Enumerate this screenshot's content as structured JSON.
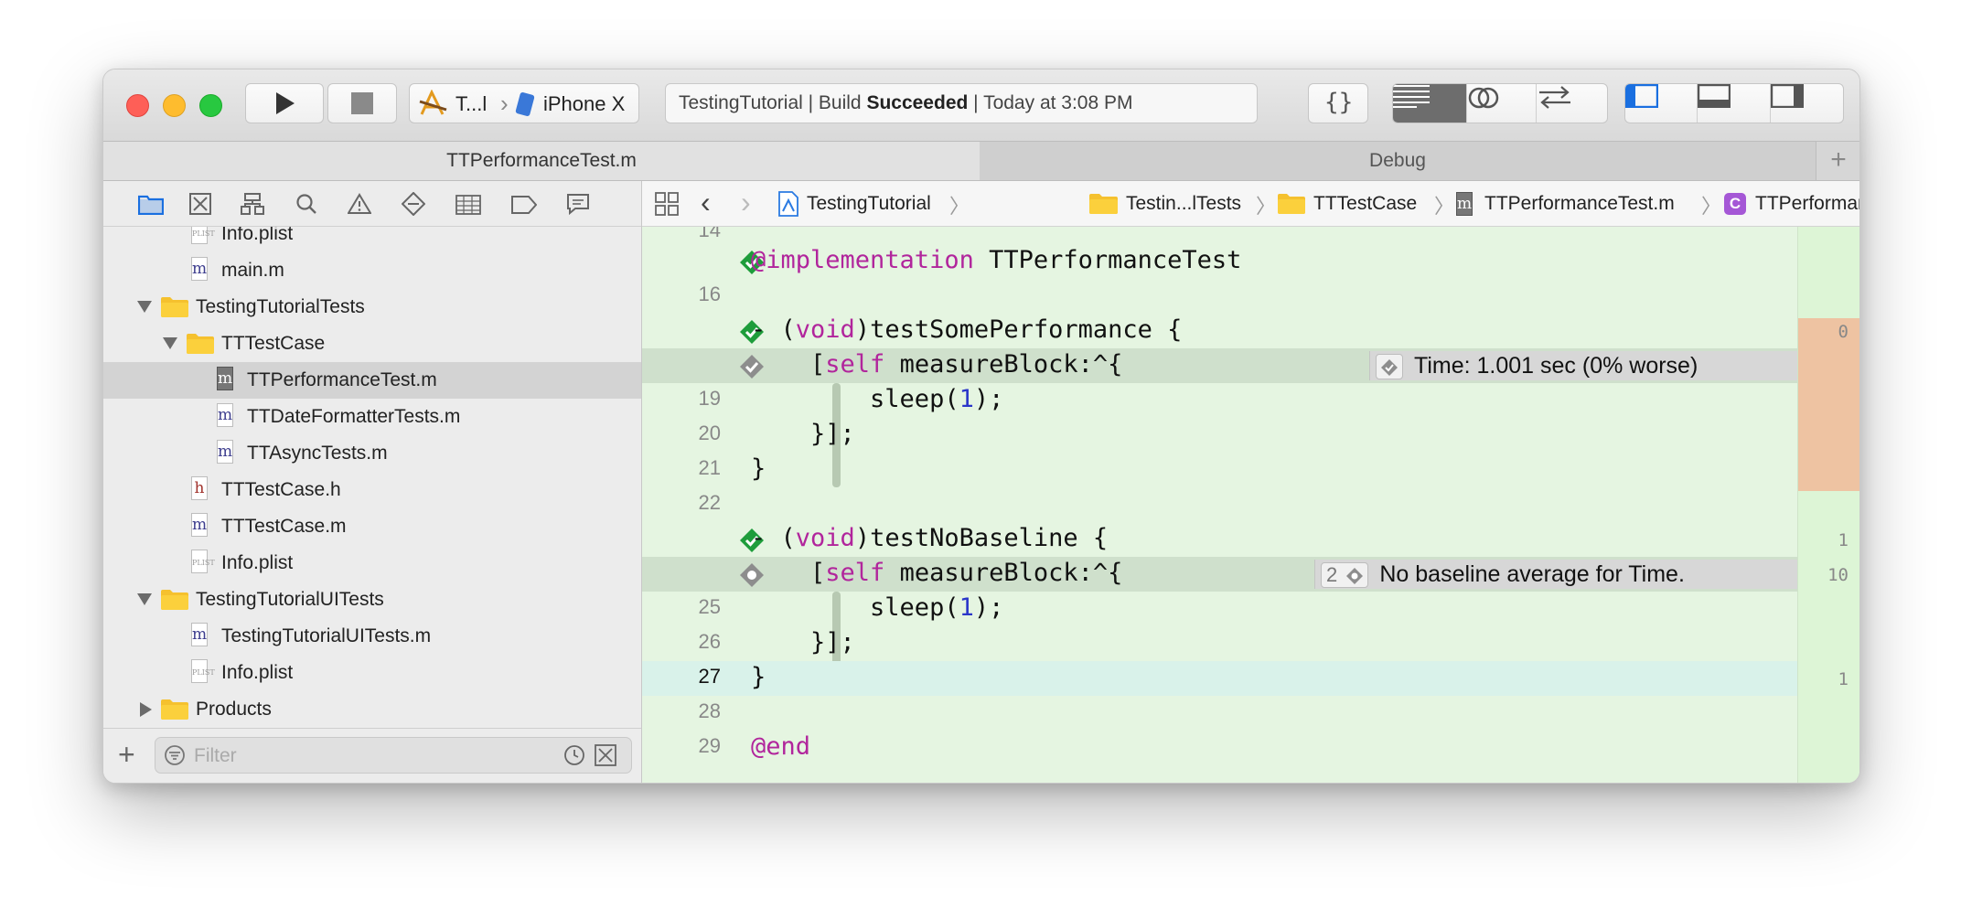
{
  "toolbar": {
    "scheme_name": "T...l",
    "device_name": "iPhone X",
    "activity": {
      "prefix": "TestingTutorial | Build ",
      "status": "Succeeded",
      "suffix": " | Today at 3:08 PM"
    }
  },
  "tabs": [
    {
      "label": "TTPerformanceTest.m",
      "active": true
    },
    {
      "label": "Debug",
      "active": false
    }
  ],
  "navigator": {
    "items": [
      {
        "label": "Info.plist",
        "icon": "plist-file-icon"
      },
      {
        "label": "main.m",
        "icon": "m-file-icon"
      },
      {
        "label": "TestingTutorialTests",
        "icon": "folder-icon",
        "expanded": true
      },
      {
        "label": "TTTestCase",
        "icon": "folder-icon",
        "expanded": true
      },
      {
        "label": "TTPerformanceTest.m",
        "icon": "m-file-icon",
        "selected": true
      },
      {
        "label": "TTDateFormatterTests.m",
        "icon": "m-file-icon"
      },
      {
        "label": "TTAsyncTests.m",
        "icon": "m-file-icon"
      },
      {
        "label": "TTTestCase.h",
        "icon": "h-file-icon"
      },
      {
        "label": "TTTestCase.m",
        "icon": "m-file-icon"
      },
      {
        "label": "Info.plist",
        "icon": "plist-file-icon"
      },
      {
        "label": "TestingTutorialUITests",
        "icon": "folder-icon",
        "expanded": true
      },
      {
        "label": "TestingTutorialUITests.m",
        "icon": "m-file-icon"
      },
      {
        "label": "Info.plist",
        "icon": "plist-file-icon"
      },
      {
        "label": "Products",
        "icon": "folder-icon",
        "expanded": false
      }
    ],
    "file_letters": {
      "m": "m",
      "h": "h"
    },
    "filter_placeholder": "Filter"
  },
  "jumpbar": {
    "crumbs": [
      "TestingTutorial",
      "Testin...lTests",
      "TTTestCase",
      "TTPerformanceTest.m",
      "TTPerformanceTest"
    ],
    "class_badge": "C"
  },
  "code": {
    "lines": [
      {
        "num": "14",
        "text": ""
      },
      {
        "num": "",
        "kw": "@implementation",
        "rest": " TTPerformanceTest",
        "marker": "pass"
      },
      {
        "num": "16",
        "text": ""
      },
      {
        "num": "",
        "pre": "- (",
        "kw": "void",
        "rest": ")testSomePerformance {",
        "marker": "pass"
      },
      {
        "num": "",
        "pre": "    [",
        "kw": "self",
        "rest": " measureBlock:^{",
        "marker": "perf",
        "annotation": "Time: 1.001 sec (0% worse)"
      },
      {
        "num": "19",
        "pre": "        sleep(",
        "n": "1",
        "rest": ");"
      },
      {
        "num": "20",
        "text": "    }];"
      },
      {
        "num": "21",
        "text": "}"
      },
      {
        "num": "22",
        "text": ""
      },
      {
        "num": "",
        "pre": "- (",
        "kw": "void",
        "rest": ")testNoBaseline {",
        "marker": "pass"
      },
      {
        "num": "",
        "pre": "    [",
        "kw": "self",
        "rest": " measureBlock:^{",
        "marker": "nobaseline",
        "annotation": "No baseline average for Time.",
        "badge": "2"
      },
      {
        "num": "25",
        "pre": "        sleep(",
        "n": "1",
        "rest": ");"
      },
      {
        "num": "26",
        "text": "    }];"
      },
      {
        "num": "27",
        "text": "}",
        "current": true
      },
      {
        "num": "28",
        "text": ""
      },
      {
        "num": "29",
        "kw": "@end",
        "rest": ""
      }
    ]
  },
  "ribbon_counts": [
    {
      "value": "0",
      "line": 3
    },
    {
      "value": "1",
      "line": 9
    },
    {
      "value": "10",
      "line": 10
    },
    {
      "value": "1",
      "line": 13
    }
  ],
  "colors": {
    "keyword": "#b1259c",
    "number": "#2b36c9",
    "test_pass": "#1e9d3b",
    "editor_bg": "#e5f5e1",
    "changed_region": "#eec3a2"
  }
}
